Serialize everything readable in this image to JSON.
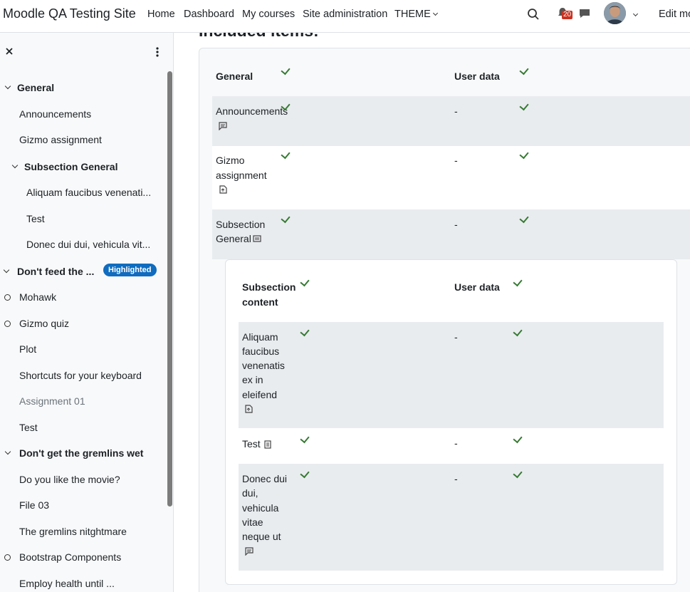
{
  "navbar": {
    "site_name": "Moodle QA Testing Site",
    "links": [
      "Home",
      "Dashboard",
      "My courses",
      "Site administration",
      "THEME"
    ],
    "notification_count": "20",
    "edit_mode": "Edit mo"
  },
  "drawer": {
    "items": [
      {
        "label": "General",
        "type": "section"
      },
      {
        "label": "Announcements",
        "type": "activity"
      },
      {
        "label": "Gizmo assignment",
        "type": "activity"
      },
      {
        "label": "Subsection General",
        "type": "subsection"
      },
      {
        "label": "Aliquam faucibus venenati...",
        "type": "activity"
      },
      {
        "label": "Test",
        "type": "activity"
      },
      {
        "label": "Donec dui dui, vehicula vit...",
        "type": "activity"
      },
      {
        "label": "Don't feed the ...",
        "type": "section",
        "badge": "Highlighted"
      },
      {
        "label": "Mohawk",
        "type": "activity"
      },
      {
        "label": "Gizmo quiz",
        "type": "activity"
      },
      {
        "label": "Plot",
        "type": "activity"
      },
      {
        "label": "Shortcuts for your keyboard",
        "type": "activity"
      },
      {
        "label": "Assignment 01",
        "type": "activity"
      },
      {
        "label": "Test",
        "type": "activity"
      },
      {
        "label": "Don't get the gremlins wet",
        "type": "section"
      },
      {
        "label": "Do you like the movie?",
        "type": "activity"
      },
      {
        "label": "File 03",
        "type": "activity"
      },
      {
        "label": "The gremlins nitghtmare",
        "type": "activity"
      },
      {
        "label": "Bootstrap Components",
        "type": "activity"
      },
      {
        "label": "Employ health until ...",
        "type": "activity"
      }
    ]
  },
  "main": {
    "heading": "Included items:",
    "table": {
      "header": {
        "col1": "General",
        "col2": "User data"
      },
      "rows": [
        {
          "name_lines": [
            "Announcements"
          ],
          "user_data": "-"
        },
        {
          "name_lines": [
            "Gizmo",
            "assignment"
          ],
          "user_data": "-"
        },
        {
          "name_lines": [
            "Subsection",
            "General"
          ],
          "user_data": "-"
        }
      ]
    },
    "subtable": {
      "header": {
        "col1_lines": [
          "Subsection",
          "content"
        ],
        "col2": "User data"
      },
      "rows": [
        {
          "name_lines": [
            "Aliquam",
            "faucibus",
            "venenatis",
            "ex in",
            "eleifend"
          ],
          "user_data": "-"
        },
        {
          "name_lines": [
            "Test"
          ],
          "user_data": "-"
        },
        {
          "name_lines": [
            "Donec dui",
            "dui,",
            "vehicula",
            "vitae",
            "neque ut"
          ],
          "user_data": "-"
        }
      ]
    }
  }
}
